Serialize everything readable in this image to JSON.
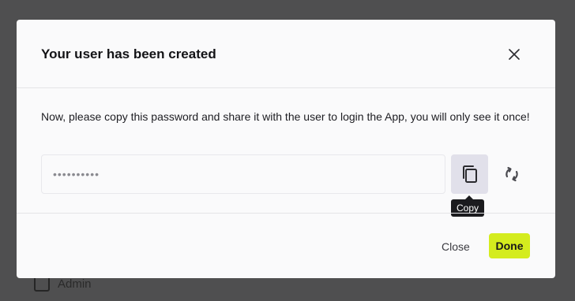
{
  "background": {
    "checkbox_label": "Admin"
  },
  "modal": {
    "title": "Your user has been created",
    "message": "Now, please copy this password and share it with the user to login the App, you will only see it once!",
    "password_value": "••••••••••",
    "copy_tooltip": "Copy",
    "close_label": "Close",
    "done_label": "Done"
  },
  "colors": {
    "overlay": "#4f4f50",
    "modal_bg": "#fafafb",
    "copy_button_bg": "#e1e0ea",
    "done_button_bg": "#d4ec1e",
    "tooltip_bg": "#1b1b1e"
  },
  "icons": {
    "close": "close-icon",
    "copy": "copy-icon",
    "regenerate": "refresh-icon"
  }
}
